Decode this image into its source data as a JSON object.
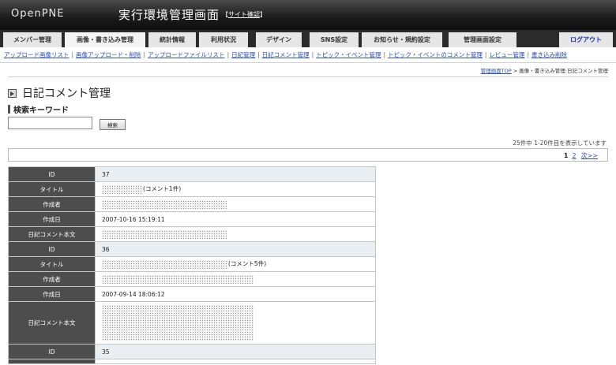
{
  "header": {
    "logo": "OpenPNE",
    "admin_title": "実行環境管理画面",
    "site_link_prefix": "【",
    "site_link": "サイト確認",
    "site_link_suffix": "】"
  },
  "tabs": [
    {
      "label": "メンバー管理"
    },
    {
      "label": "画像・書き込み管理"
    },
    {
      "label": "統計情報"
    },
    {
      "label": "利用状況"
    },
    {
      "label": "デザイン"
    },
    {
      "label": "SNS設定"
    },
    {
      "label": "お知らせ・規約設定"
    },
    {
      "label": "管理画面設定"
    },
    {
      "label": "ログアウト"
    }
  ],
  "subnav": [
    {
      "label": "アップロード画像リスト"
    },
    {
      "label": "画像アップロード・削除"
    },
    {
      "label": "アップロードファイルリスト"
    },
    {
      "label": "日記管理"
    },
    {
      "label": "日記コメント管理"
    },
    {
      "label": "トピック・イベント管理"
    },
    {
      "label": "トピック・イベントのコメント管理"
    },
    {
      "label": "レビュー管理"
    },
    {
      "label": "書き込み削除"
    }
  ],
  "breadcrumb": {
    "home": "管理画面TOP",
    "sep": " > ",
    "rest": "画像・書き込み管理:日記コメント管理"
  },
  "page": {
    "title": "日記コメント管理",
    "section_title": "検索キーワード"
  },
  "search": {
    "value": "",
    "placeholder": "",
    "button_label": "検索"
  },
  "results": {
    "count_text": "25件中 1-20件目を表示しています"
  },
  "pager": {
    "current": "1",
    "page2": "2",
    "next": "次>>"
  },
  "labels": {
    "id": "ID",
    "title": "タイトル",
    "author": "作成者",
    "date": "作成日",
    "body": "日記コメント本文"
  },
  "records": [
    {
      "id": "37",
      "title_suffix": "(コメント1件)",
      "date": "2007-10-16 15:19:11"
    },
    {
      "id": "36",
      "title_suffix": "(コメント5件)",
      "date": "2007-09-14 18:06:12"
    },
    {
      "id": "35"
    }
  ]
}
